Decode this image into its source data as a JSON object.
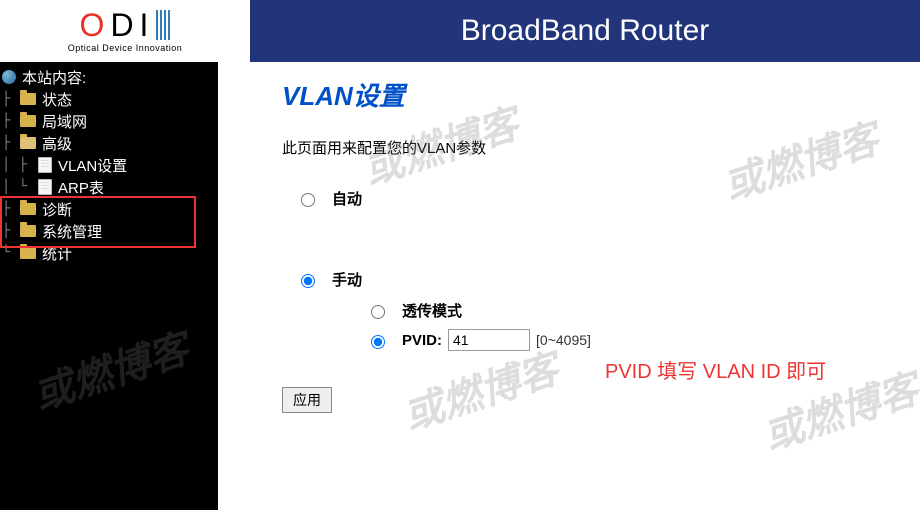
{
  "logo": {
    "text": "ODI",
    "tagline": "Optical Device Innovation"
  },
  "banner": {
    "title": "BroadBand Router"
  },
  "sidebar": {
    "root": "本站内容:",
    "items": [
      {
        "label": "状态",
        "type": "folder"
      },
      {
        "label": "局域网",
        "type": "folder"
      },
      {
        "label": "高级",
        "type": "folder-open",
        "children": [
          {
            "label": "VLAN设置",
            "type": "page"
          },
          {
            "label": "ARP表",
            "type": "page"
          }
        ]
      },
      {
        "label": "诊断",
        "type": "folder"
      },
      {
        "label": "系统管理",
        "type": "folder"
      },
      {
        "label": "统计",
        "type": "folder"
      }
    ]
  },
  "content": {
    "title": "VLAN设置",
    "desc": "此页面用来配置您的VLAN参数",
    "mode_auto": "自动",
    "mode_manual": "手动",
    "sub_transparent": "透传模式",
    "sub_pvid_label": "PVID:",
    "pvid_value": "41",
    "pvid_range": "[0~4095]",
    "apply": "应用",
    "selected_mode": "manual",
    "selected_sub": "pvid"
  },
  "annotation": "PVID 填写 VLAN ID 即可",
  "watermark": "或燃博客"
}
